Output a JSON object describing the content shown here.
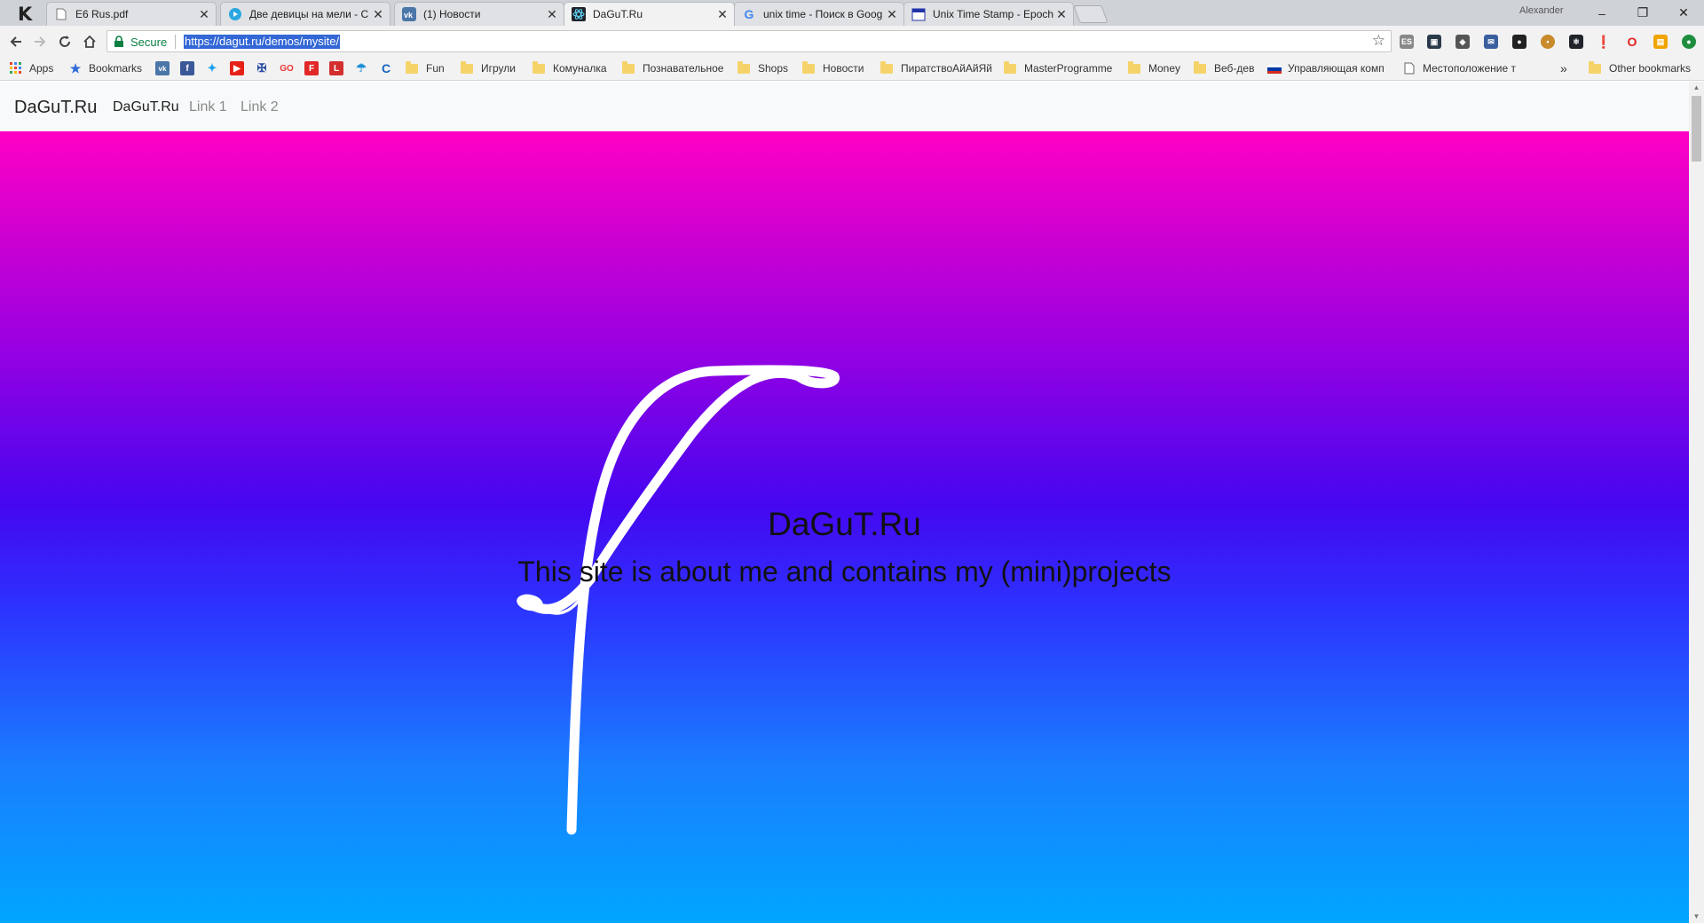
{
  "browser": {
    "tabs": [
      {
        "title": "E6 Rus.pdf",
        "icon": "pdf-document-icon"
      },
      {
        "title": "Две девицы на мели - С",
        "icon": "play-circle-icon"
      },
      {
        "title": "(1) Новости",
        "icon": "vk-icon"
      },
      {
        "title": "DaGuT.Ru",
        "icon": "react-atom-icon",
        "active": true
      },
      {
        "title": "unix time - Поиск в Goog",
        "icon": "google-icon"
      },
      {
        "title": "Unix Time Stamp - Epoch",
        "icon": "calendar-icon"
      }
    ],
    "profile_name": "Alexander",
    "window_controls": {
      "minimize": "–",
      "maximize": "❐",
      "close": "✕"
    },
    "address_bar": {
      "secure_label": "Secure",
      "url": "https://dagut.ru/demos/mysite/"
    },
    "extensions": [
      "es-icon",
      "screen-icon",
      "shield-icon",
      "mail-new-icon",
      "ghost-icon",
      "cookie-icon",
      "react-icon",
      "bulb-icon",
      "opera-icon",
      "gift-icon",
      "green-circle-icon"
    ],
    "bookmarks": [
      {
        "label": "Apps",
        "icon": "apps-grid-icon"
      },
      {
        "label": "Bookmarks",
        "icon": "star-icon"
      },
      {
        "label": "",
        "icon": "vk-icon"
      },
      {
        "label": "",
        "icon": "facebook-icon"
      },
      {
        "label": "",
        "icon": "twitter-icon"
      },
      {
        "label": "",
        "icon": "youtube-icon"
      },
      {
        "label": "",
        "icon": "emblem-icon"
      },
      {
        "label": "",
        "icon": "go-icon"
      },
      {
        "label": "",
        "icon": "flipboard-icon"
      },
      {
        "label": "",
        "icon": "red-l-icon"
      },
      {
        "label": "",
        "icon": "umbrella-icon"
      },
      {
        "label": "",
        "icon": "c-icon"
      },
      {
        "label": "Fun",
        "icon": "folder-icon"
      },
      {
        "label": "Игрули",
        "icon": "folder-icon"
      },
      {
        "label": "Комуналка",
        "icon": "folder-icon"
      },
      {
        "label": "Познавательное",
        "icon": "folder-icon"
      },
      {
        "label": "Shops",
        "icon": "folder-icon"
      },
      {
        "label": "Новости",
        "icon": "folder-icon"
      },
      {
        "label": "ПиратствоАйАйЯй",
        "icon": "folder-icon"
      },
      {
        "label": "MasterProgramme",
        "icon": "folder-icon"
      },
      {
        "label": "Money",
        "icon": "folder-icon"
      },
      {
        "label": "Веб-дев",
        "icon": "folder-icon"
      },
      {
        "label": "Управляющая комп",
        "icon": "russian-flag-icon"
      },
      {
        "label": "Местоположение т",
        "icon": "page-icon"
      }
    ],
    "overflow_label": "»",
    "other_bookmarks": "Other bookmarks"
  },
  "site": {
    "nav": {
      "brand": "DaGuT.Ru",
      "links": [
        "DaGuT.Ru",
        "Link 1",
        "Link 2"
      ]
    },
    "hero": {
      "title": "DaGuT.Ru",
      "subtitle": "This site is about me and contains my (mini)projects"
    }
  },
  "colors": {
    "hero_gradient_top": "#ff00c3",
    "hero_gradient_middle": "#4606f0",
    "hero_gradient_bottom": "#00a6ff",
    "secure_green": "#0b8043",
    "url_selection": "#3367d6"
  }
}
